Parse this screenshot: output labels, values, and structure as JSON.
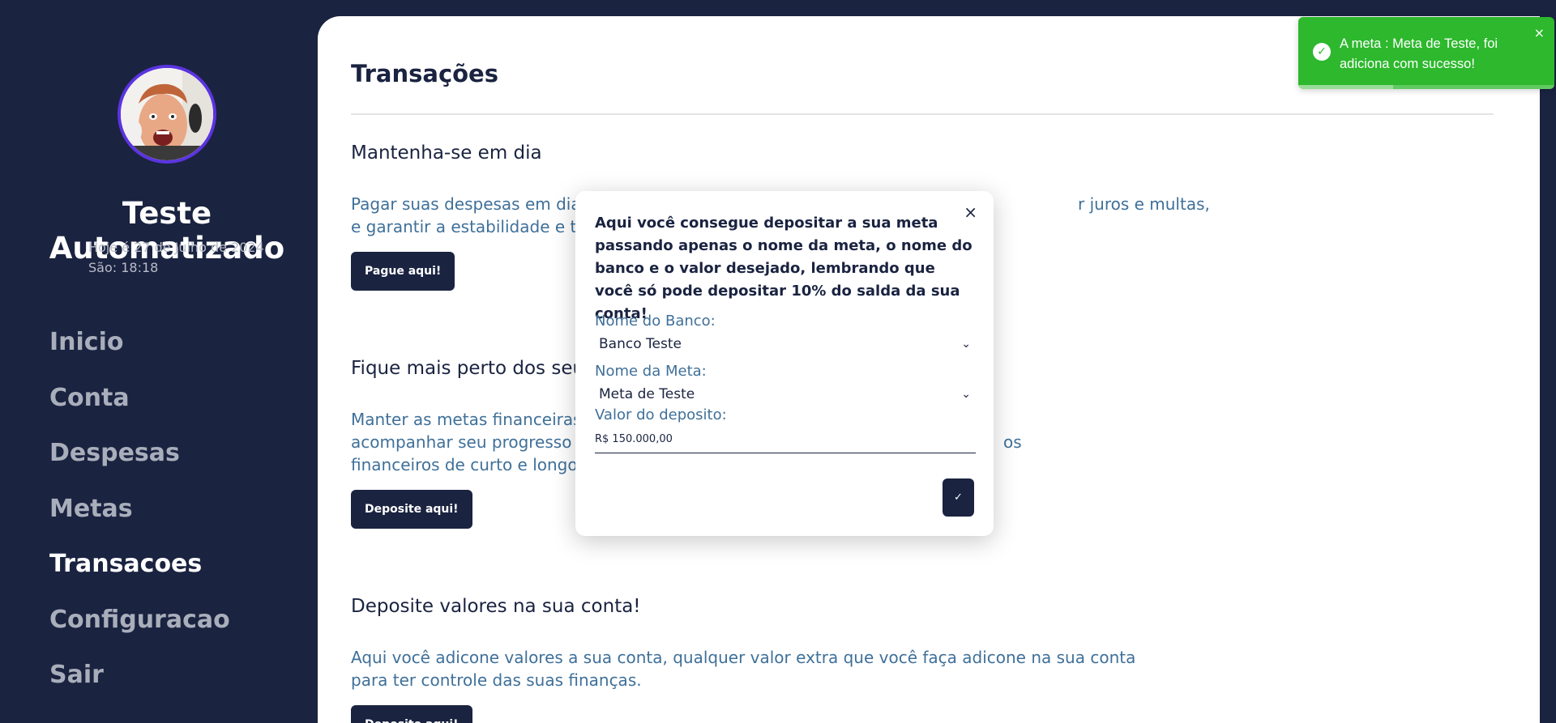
{
  "sidebar": {
    "user_name": "Teste Automatizado",
    "date_text": "Hoje é 27 de Julho de 2024",
    "time_text": "São: 18:18",
    "nav": [
      {
        "label": "Inicio",
        "active": false
      },
      {
        "label": "Conta",
        "active": false
      },
      {
        "label": "Despesas",
        "active": false
      },
      {
        "label": "Metas",
        "active": false
      },
      {
        "label": "Transacoes",
        "active": true
      },
      {
        "label": "Configuracao",
        "active": false
      },
      {
        "label": "Sair",
        "active": false
      }
    ]
  },
  "main": {
    "title": "Transações",
    "sections": [
      {
        "title": "Mantenha-se em dia",
        "text_line1": "Pagar suas despesas em dia é fu",
        "text_line1_end": "r juros e multas,",
        "text_line2": "e garantir a estabilidade e tranq",
        "button": "Pague aqui!"
      },
      {
        "title": "Fique mais perto dos seus",
        "text_line1": "Manter as metas financeiras atu",
        "text_line2": "acompanhar seu progresso e ga",
        "text_line2_end": "os",
        "text_line3": "financeiros de curto e longo pra",
        "button": "Deposite aqui!"
      },
      {
        "title": "Deposite valores na sua conta!",
        "text_line1": "Aqui você adicone valores a sua conta, qualquer valor extra que você faça adicone na sua conta",
        "text_line2": "para ter controle das suas finanças.",
        "button": "Deposite aqui!"
      }
    ]
  },
  "modal": {
    "close_symbol": "×",
    "description": "Aqui você consegue depositar a sua meta passando apenas o nome da meta, o nome do banco e o valor desejado, lembrando que você só pode depositar 10% do salda da sua conta!",
    "bank_label": "Nome do Banco:",
    "bank_value": "Banco Teste",
    "goal_label": "Nome da Meta:",
    "goal_value": "Meta de Teste",
    "amount_label": "Valor do deposito:",
    "amount_value": "R$ 150.000,00",
    "confirm_symbol": "✓"
  },
  "toast": {
    "message": "A meta : Meta de Teste, foi adiciona com sucesso!",
    "close_symbol": "×",
    "progress": 0.37,
    "color": "#2db82d"
  },
  "colors": {
    "sidebar_bg": "#1a2340",
    "accent_text": "#3f7099",
    "avatar_border": "#5b34e0"
  }
}
